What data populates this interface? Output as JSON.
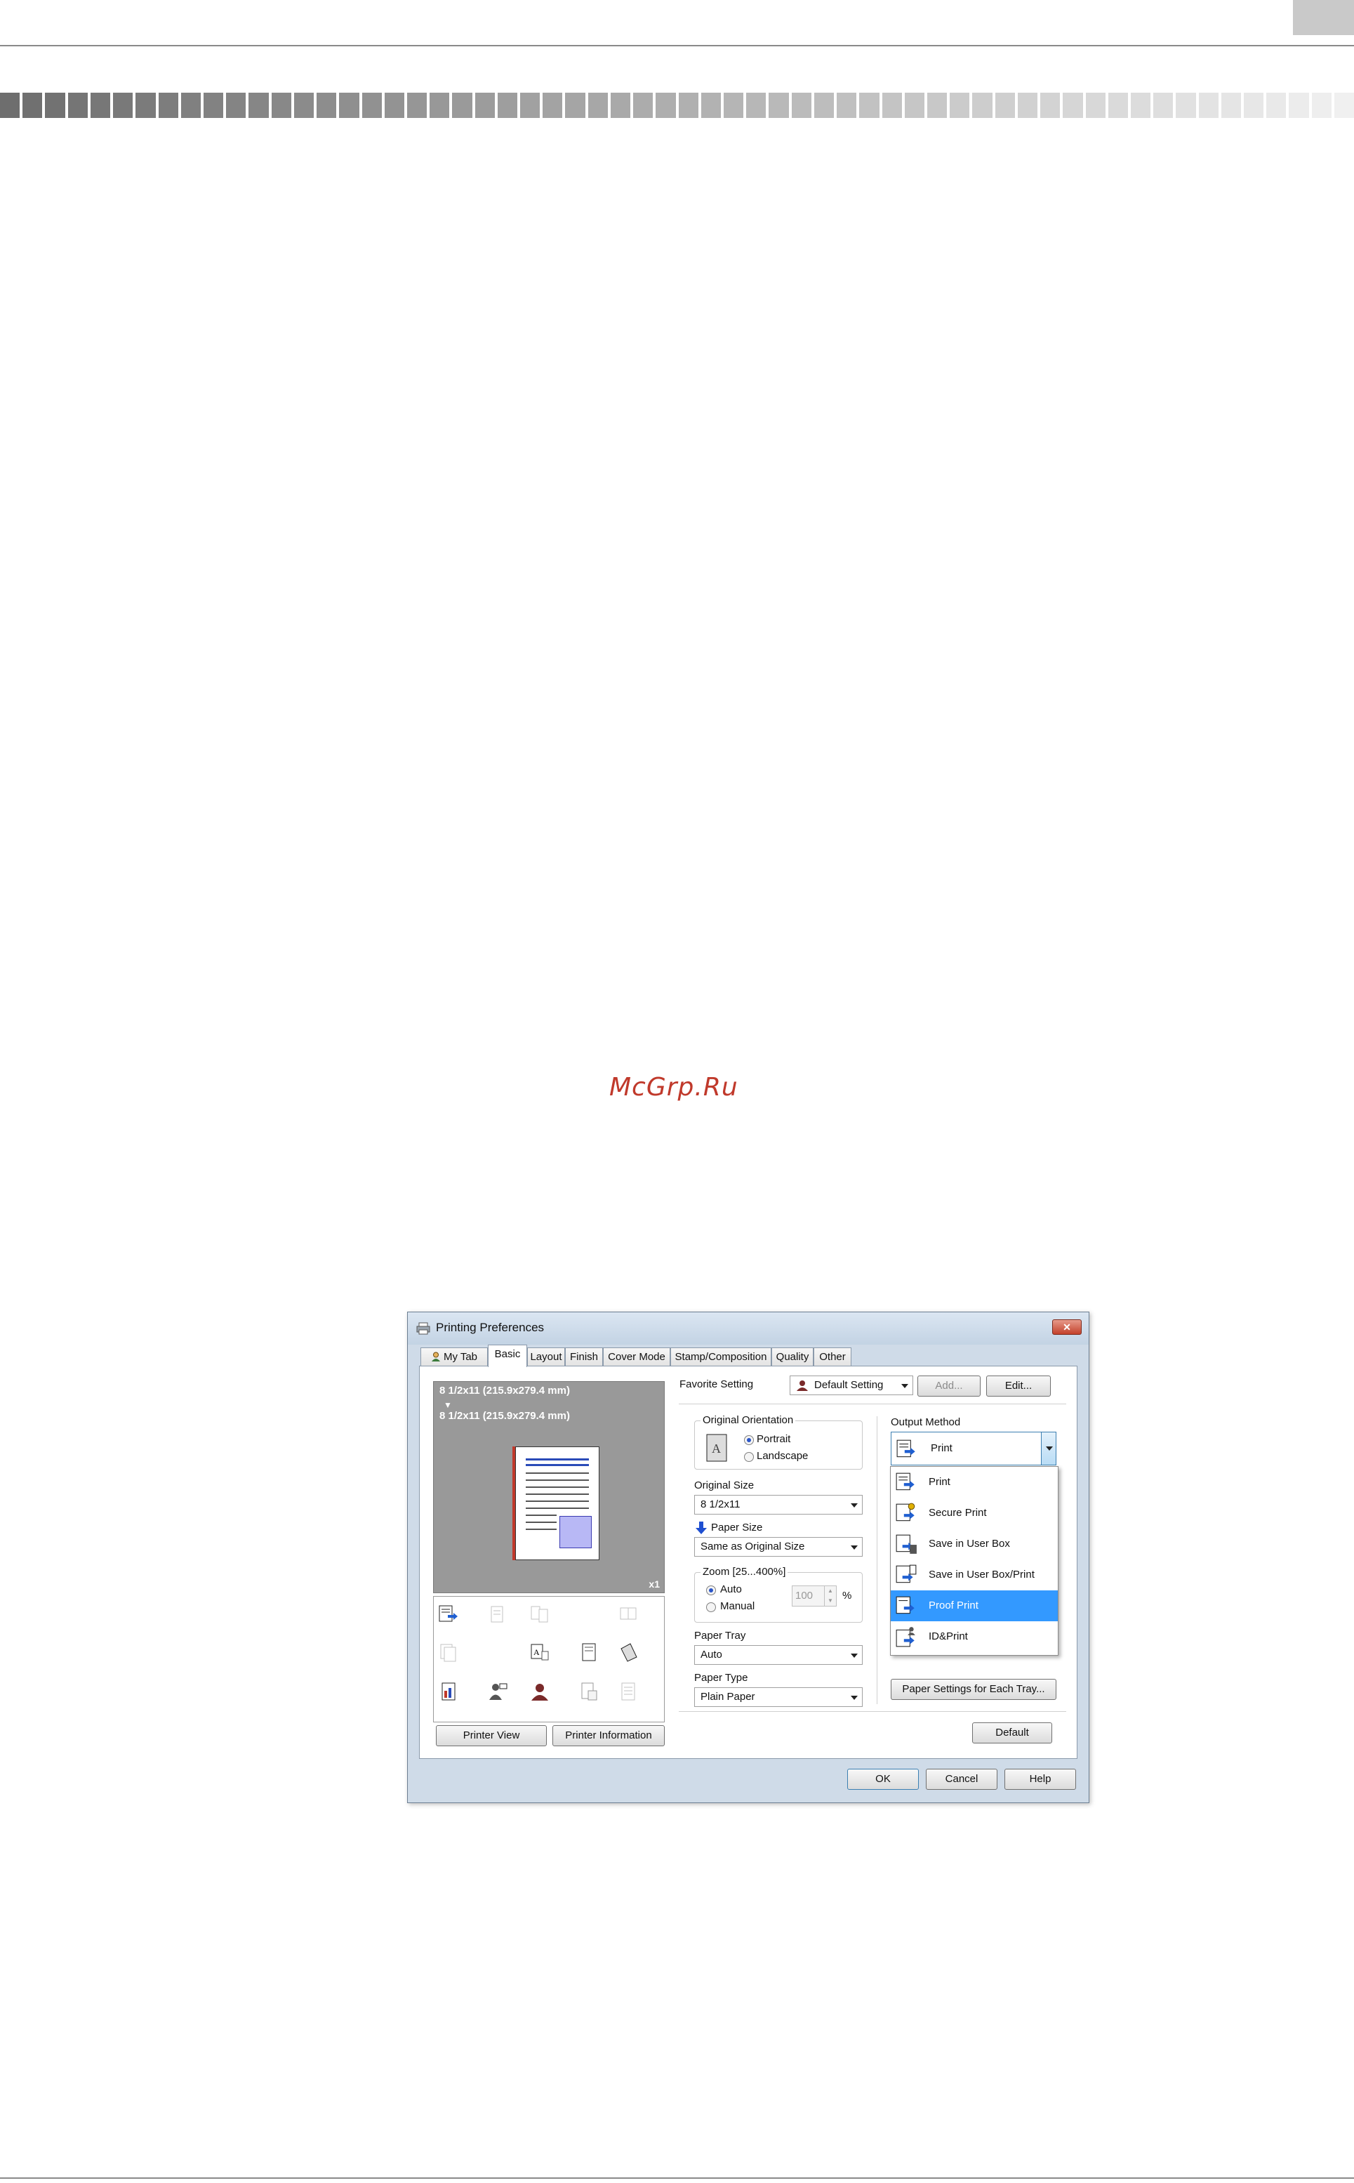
{
  "watermark": "McGrp.Ru",
  "dialog": {
    "title": "Printing Preferences",
    "close_label": "✕",
    "tabs": [
      "My Tab",
      "Basic",
      "Layout",
      "Finish",
      "Cover Mode",
      "Stamp/Composition",
      "Quality",
      "Other"
    ],
    "active_tab": "Basic",
    "preview": {
      "original_size": "8 1/2x11 (215.9x279.4 mm)",
      "arrow": "▼",
      "paper_size": "8 1/2x11 (215.9x279.4 mm)",
      "copies": "x1"
    },
    "printer_view_label": "Printer View",
    "printer_information_label": "Printer Information",
    "favorite_setting": {
      "label": "Favorite Setting",
      "value": "Default Setting",
      "add_label": "Add...",
      "edit_label": "Edit..."
    },
    "original_orientation": {
      "label": "Original Orientation",
      "options": [
        "Portrait",
        "Landscape"
      ],
      "selected": "Portrait"
    },
    "original_size": {
      "label": "Original Size",
      "value": "8 1/2x11"
    },
    "paper_size": {
      "label": "Paper Size",
      "value": "Same as Original Size"
    },
    "zoom": {
      "label": "Zoom [25...400%]",
      "options": [
        "Auto",
        "Manual"
      ],
      "selected": "Auto",
      "value": "100",
      "unit": "%"
    },
    "paper_tray": {
      "label": "Paper Tray",
      "value": "Auto"
    },
    "paper_type": {
      "label": "Paper Type",
      "value": "Plain Paper"
    },
    "output_method": {
      "label": "Output Method",
      "value": "Print",
      "options": [
        "Print",
        "Secure Print",
        "Save in User Box",
        "Save in User Box/Print",
        "Proof Print",
        "ID&Print"
      ],
      "highlighted": "Proof Print"
    },
    "paper_settings_label": "Paper Settings for Each Tray...",
    "default_label": "Default",
    "ok_label": "OK",
    "cancel_label": "Cancel",
    "help_label": "Help"
  }
}
